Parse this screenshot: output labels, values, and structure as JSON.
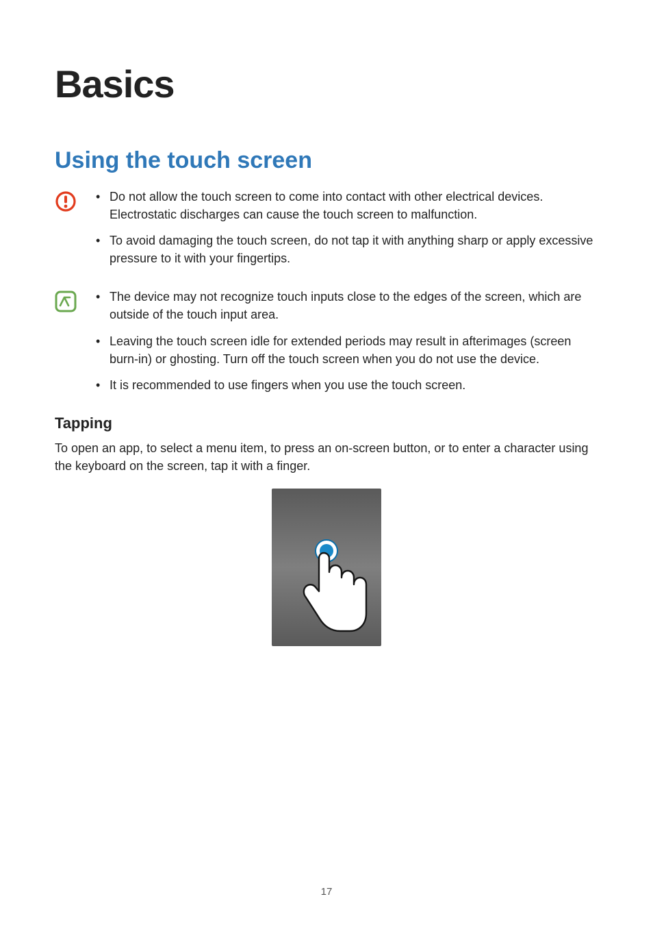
{
  "title": "Basics",
  "section_title": "Using the touch screen",
  "caution_bullets": [
    "Do not allow the touch screen to come into contact with other electrical devices. Electrostatic discharges can cause the touch screen to malfunction.",
    "To avoid damaging the touch screen, do not tap it with anything sharp or apply excessive pressure to it with your fingertips."
  ],
  "note_bullets": [
    "The device may not recognize touch inputs close to the edges of the screen, which are outside of the touch input area.",
    "Leaving the touch screen idle for extended periods may result in afterimages (screen burn-in) or ghosting. Turn off the touch screen when you do not use the device.",
    "It is recommended to use fingers when you use the touch screen."
  ],
  "sub_heading": "Tapping",
  "sub_paragraph": "To open an app, to select a menu item, to press an on-screen button, or to enter a character using the keyboard on the screen, tap it with a finger.",
  "page_number": "17"
}
